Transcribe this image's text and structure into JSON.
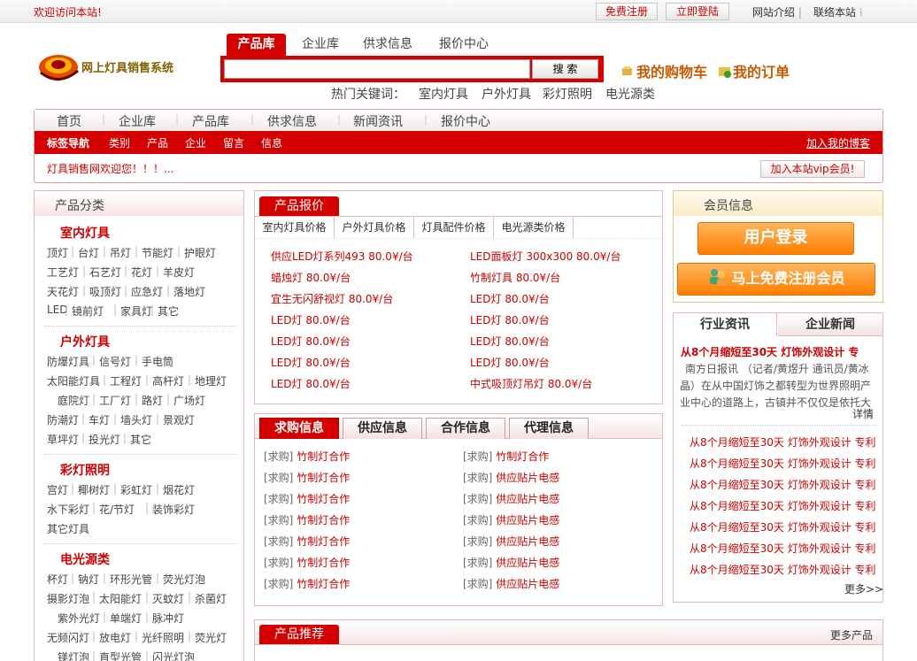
{
  "topbar": {
    "welcome": "欢迎访问本站!",
    "register": "免费注册",
    "login": "立即登陆",
    "intro": "网站介绍",
    "favorite": "联络本站"
  },
  "logo": {
    "text": "网上灯具销售系统"
  },
  "search": {
    "tabs": [
      "产品库",
      "企业库",
      "供求信息",
      "报价中心"
    ],
    "button": "搜 索",
    "placeholder": "",
    "hot_label": "热门关键词：",
    "hot": [
      "室内灯具",
      "户外灯具",
      "彩灯照明",
      "电光源类"
    ]
  },
  "header": {
    "cart": "我的购物车",
    "orders": "我的订单"
  },
  "nav": {
    "main": [
      "首页",
      "企业库",
      "产品库",
      "供求信息",
      "新闻资讯",
      "报价中心"
    ],
    "sub_title": "标签导航",
    "sub": [
      "类别",
      "产品",
      "企业",
      "留言",
      "信息"
    ],
    "blog": "加入我的博客",
    "scroll": "灯具销售网欢迎您！！！...",
    "vip": "加入本站vip会员!"
  },
  "categories": {
    "title": "产品分类",
    "groups": [
      {
        "name": "室内灯具",
        "rows": [
          [
            "顶灯",
            "台灯",
            "吊灯",
            "节能灯",
            "护眼灯"
          ],
          [
            "工艺灯",
            "石艺灯",
            "花灯",
            "羊皮灯"
          ],
          [
            "天花灯",
            "吸顶灯",
            "应急灯",
            "落地灯"
          ],
          [
            "LED",
            "镜前灯",
            "家具灯",
            "其它"
          ]
        ]
      },
      {
        "name": "户外灯具",
        "rows": [
          [
            "防爆灯具",
            "信号灯",
            "手电筒"
          ],
          [
            "太阳能灯具",
            "工程灯",
            "高杆灯",
            "地理灯"
          ],
          [
            "庭院灯",
            "工厂灯",
            "路灯",
            "广场灯"
          ],
          [
            "防潮灯",
            "车灯",
            "墙头灯",
            "景观灯"
          ],
          [
            "草坪灯",
            "投光灯",
            "其它"
          ]
        ]
      },
      {
        "name": "彩灯照明",
        "rows": [
          [
            "宫灯",
            "椰树灯",
            "彩虹灯",
            "烟花灯"
          ],
          [
            "水下彩灯",
            "花/节灯",
            "装饰彩灯"
          ],
          [
            "其它灯具"
          ]
        ]
      },
      {
        "name": "电光源类",
        "rows": [
          [
            "杯灯",
            "钠灯",
            "环形光管",
            "荧光灯泡"
          ],
          [
            "摄影灯泡",
            "太阳能灯",
            "灭蚊灯",
            "杀菌灯"
          ],
          [
            "紫外光灯",
            "单端灯",
            "脉冲灯"
          ],
          [
            "无频闪灯",
            "放电灯",
            "光纤照明",
            "荧光灯"
          ],
          [
            "镁灯泡",
            "直型光管",
            "闪光灯泡"
          ]
        ]
      }
    ]
  },
  "prices": {
    "tab": "产品报价",
    "subtabs": [
      "室内灯具价格",
      "户外灯具价格",
      "灯具配件价格",
      "电光源类价格"
    ],
    "left": [
      "供应LED灯系列493 80.0¥/台",
      "蜡烛灯 80.0¥/台",
      "宜生无闪舒视灯 80.0¥/台",
      "LED灯 80.0¥/台",
      "LED灯 80.0¥/台",
      "LED灯 80.0¥/台",
      "LED灯 80.0¥/台"
    ],
    "right": [
      "LED面板灯 300x300 80.0¥/台",
      "竹制灯具 80.0¥/台",
      "LED灯 80.0¥/台",
      "LED灯 80.0¥/台",
      "LED灯 80.0¥/台",
      "LED灯 80.0¥/台",
      "中式吸顶灯吊灯 80.0¥/台"
    ]
  },
  "info": {
    "tabs": [
      "求购信息",
      "供应信息",
      "合作信息",
      "代理信息"
    ],
    "left": [
      [
        "[求购]",
        "竹制灯合作"
      ],
      [
        "[求购]",
        "竹制灯合作"
      ],
      [
        "[求购]",
        "竹制灯合作"
      ],
      [
        "[求购]",
        "竹制灯合作"
      ],
      [
        "[求购]",
        "竹制灯合作"
      ],
      [
        "[求购]",
        "竹制灯合作"
      ],
      [
        "[求购]",
        "竹制灯合作"
      ]
    ],
    "right": [
      [
        "[求购]",
        "竹制灯合作"
      ],
      [
        "[求购]",
        "供应贴片电感"
      ],
      [
        "[求购]",
        "供应贴片电感"
      ],
      [
        "[求购]",
        "供应贴片电感"
      ],
      [
        "[求购]",
        "供应贴片电感"
      ],
      [
        "[求购]",
        "供应贴片电感"
      ],
      [
        "[求购]",
        "供应贴片电感"
      ]
    ]
  },
  "recommend": {
    "tab": "产品推荐",
    "more": "更多产品"
  },
  "member": {
    "title": "会员信息",
    "login": "用户登录",
    "register": "马上免费注册会员"
  },
  "news": {
    "tabs": [
      "行业资讯",
      "企业新闻"
    ],
    "headline": "从8个月缩短至30天 灯饰外观设计 专",
    "desc": "南方日报讯 （记者/黄煜升 通讯员/黄冰晶）在从中国灯饰之都转型为世界照明产业中心的道路上，古镇并不仅仅是依托大",
    "detail": "详情",
    "items": [
      "从8个月缩短至30天 灯饰外观设计 专利",
      "从8个月缩短至30天 灯饰外观设计 专利",
      "从8个月缩短至30天 灯饰外观设计 专利",
      "从8个月缩短至30天 灯饰外观设计 专利",
      "从8个月缩短至30天 灯饰外观设计 专利",
      "从8个月缩短至30天 灯饰外观设计 专利",
      "从8个月缩短至30天 灯饰外观设计 专利"
    ],
    "more": "更多>>"
  }
}
